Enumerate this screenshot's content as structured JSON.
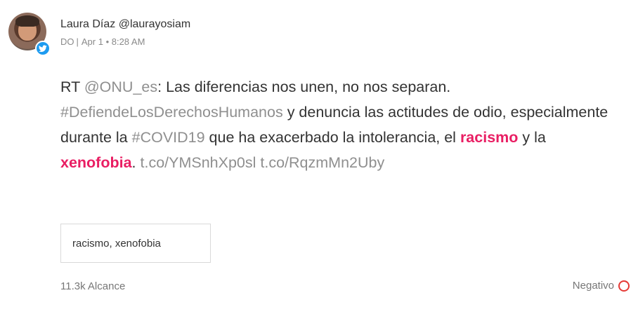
{
  "author": {
    "display": "Laura Díaz @laurayosiam",
    "source": "DO",
    "separator": "|",
    "timestamp": "Apr 1 • 8:28 AM"
  },
  "tweet": {
    "segments": [
      {
        "text": "RT ",
        "style": "normal"
      },
      {
        "text": "@ONU_es",
        "style": "muted"
      },
      {
        "text": ": Las diferencias nos unen, no nos separan. ",
        "style": "normal"
      },
      {
        "text": "#DefiendeLosDerechosHumanos",
        "style": "muted"
      },
      {
        "text": " y denuncia las actitudes de odio, especialmente durante la ",
        "style": "normal"
      },
      {
        "text": "#COVID19",
        "style": "muted"
      },
      {
        "text": " que ha exacerbado la intolerancia, el ",
        "style": "normal"
      },
      {
        "text": "racismo",
        "style": "hl"
      },
      {
        "text": " y la ",
        "style": "normal"
      },
      {
        "text": "xenofobia",
        "style": "hl"
      },
      {
        "text": ". ",
        "style": "normal"
      },
      {
        "text": "t.co/YMSnhXp0sl",
        "style": "muted"
      },
      {
        "text": " ",
        "style": "normal"
      },
      {
        "text": "t.co/RqzmMn2Uby",
        "style": "muted"
      }
    ]
  },
  "keywords": "racismo, xenofobia",
  "reach": "11.3k Alcance",
  "sentiment": {
    "label": "Negativo",
    "color": "#e53935"
  },
  "colors": {
    "highlight": "#e91e63",
    "twitter": "#1d9bf0"
  },
  "icons": {
    "network": "twitter-icon",
    "sentiment": "negative-circle-icon"
  }
}
